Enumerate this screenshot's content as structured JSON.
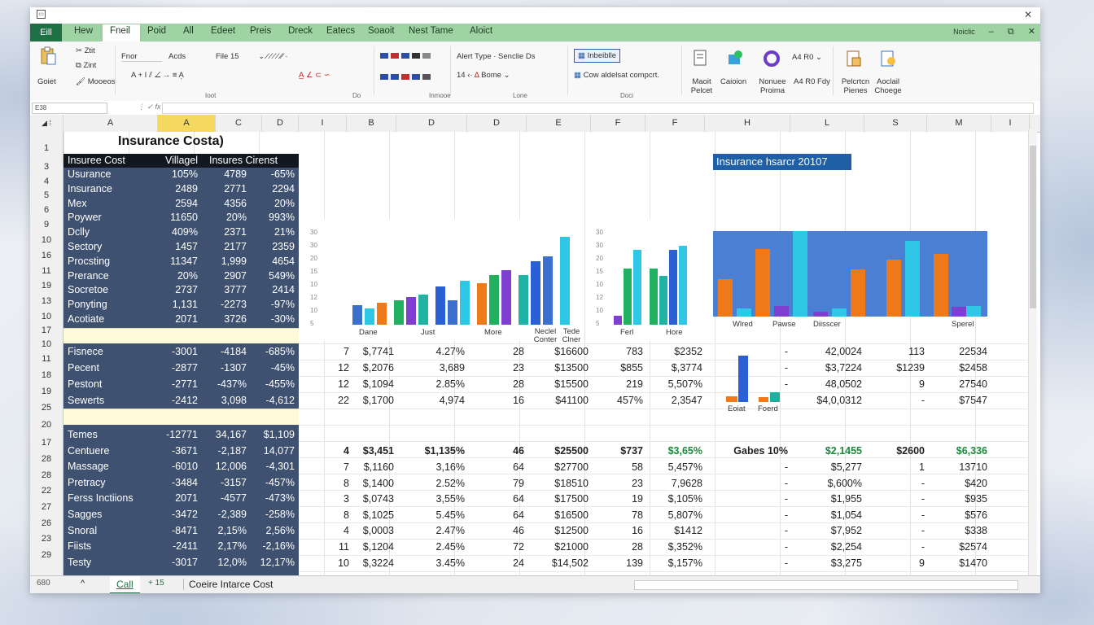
{
  "ribbon_tabs": [
    "Eill",
    "Hew",
    "Fneil",
    "Poid",
    "All",
    "Edeet",
    "Preis",
    "Dreck",
    "Eatecs",
    "Soaoit",
    "Nest Tame",
    "Aloict"
  ],
  "window_ctrls": [
    "Noiclic",
    "–",
    "⧉",
    "✕"
  ],
  "ribbon": {
    "paste_label": "Goiet",
    "clip_items": [
      "Ztit",
      "Zint",
      "Mooeos"
    ],
    "font_name": "Fnor",
    "font_size": "Acds",
    "font_menu": "File 15",
    "alert_type": "Alert Type · Senclie Ds",
    "bome": "Bome",
    "ibboi": "Inbeiblle",
    "cow_text": "Cow aldelsat compcrt.",
    "big_btns": [
      "Maoit Pelcet",
      "Caioion",
      "Nonuee Proima",
      "A4 R0 Fdy"
    ],
    "right_btns": [
      "Pelcrtcn Pienes",
      "Aoclail Choege"
    ],
    "group_labels": [
      "Ioot",
      "Do",
      "Inmooe",
      "Lone",
      "Doci"
    ]
  },
  "namebox": "E38",
  "columns": [
    "A",
    "A",
    "C",
    "D",
    "I",
    "B",
    "D",
    "D",
    "E",
    "F",
    "F",
    "H",
    "L",
    "S",
    "M",
    "I"
  ],
  "rows": [
    "1",
    "3",
    "4",
    "5",
    "6",
    "9",
    "10",
    "16",
    "11",
    "19",
    "13",
    "10",
    "17",
    "10",
    "11",
    "18",
    "19",
    "25",
    "20",
    "17",
    "28",
    "28",
    "22",
    "27",
    "26",
    "23",
    "29"
  ],
  "sheet_title": "Insurance Costa)",
  "table_header": [
    "Insuree Cost",
    "Villagel",
    "Insures Cirenst"
  ],
  "table_rows": [
    [
      "Usurance",
      "105%",
      "4789",
      "-65%"
    ],
    [
      "Insurance",
      "2489",
      "2771",
      "2294"
    ],
    [
      "Mex",
      "2594",
      "4356",
      "20%"
    ],
    [
      "Poywer",
      "11650",
      "20%",
      "993%"
    ],
    [
      "Dclly",
      "409%",
      "2371",
      "21%"
    ],
    [
      "Sectory",
      "1457",
      "2177",
      "2359"
    ],
    [
      "Procsting",
      "11347",
      "1,999",
      "4654"
    ],
    [
      "Prerance",
      "20%",
      "2907",
      "549%"
    ],
    [
      "Socretoe",
      "2737",
      "3777",
      "2414"
    ],
    [
      "Ponyting",
      "1,131",
      "-2273",
      "-97%"
    ],
    [
      "Acotiate",
      "2071",
      "3726",
      "-30%"
    ]
  ],
  "table_rows2": [
    [
      "Fisnece",
      "-3001",
      "-4184",
      "-685%"
    ],
    [
      "Pecent",
      "-2877",
      "-1307",
      "-45%"
    ],
    [
      "Pestont",
      "-2771",
      "-437%",
      "-455%"
    ],
    [
      "Sewerts",
      "-2412",
      "3,098",
      "-4,612"
    ]
  ],
  "table_rows3": [
    [
      "Temes",
      "-12771",
      "34,167",
      "$1,109"
    ],
    [
      "Centuere",
      "-3671",
      "-2,187",
      "14,077"
    ],
    [
      "Massage",
      "-6010",
      "12,006",
      "-4,301"
    ],
    [
      "Pretracy",
      "-3484",
      "-3157",
      "-457%"
    ],
    [
      "Ferss Inctiions",
      "2071",
      "-4577",
      "-473%"
    ],
    [
      "Sagges",
      "-3472",
      "-2,389",
      "-258%"
    ],
    [
      "Snoral",
      "-8471",
      "2,15%",
      "2,56%"
    ],
    [
      "Fiists",
      "-2411",
      "2,17%",
      "-2,16%"
    ],
    [
      "Testy",
      "-3017",
      "12,0%",
      "12,17%"
    ]
  ],
  "right_block1": [
    [
      "7",
      "$,7741",
      "4.27%",
      "28",
      "$16600",
      "783",
      "$2352",
      "-",
      "42,0024",
      "113",
      "22534"
    ],
    [
      "12",
      "$,2076",
      "3,689",
      "23",
      "$13500",
      "$855",
      "$,3774",
      "-",
      "$3,7224",
      "$1239",
      "$2458"
    ],
    [
      "12",
      "$,1094",
      "2.85%",
      "28",
      "$15500",
      "219",
      "5,507%",
      "-",
      "48,0502",
      "9",
      "27540"
    ],
    [
      "22",
      "$,1700",
      "4,974",
      "16",
      "$41100",
      "457%",
      "2,3547",
      "",
      "$4,0,0312",
      "-",
      "$7547"
    ]
  ],
  "bold_row": [
    "4",
    "$3,451",
    "$1,135%",
    "46",
    "$25500",
    "$737",
    "$3,65%",
    "Gabes 10%",
    "$2,1455",
    "$2600",
    "$6,336"
  ],
  "right_block2": [
    [
      "7",
      "$,1160",
      "3,16%",
      "64",
      "$27700",
      "58",
      "5,457%",
      "-",
      "$5,277",
      "1",
      "13710"
    ],
    [
      "8",
      "$,1400",
      "2.52%",
      "79",
      "$18510",
      "23",
      "7,9628",
      "-",
      "$,600%",
      "-",
      "$420"
    ],
    [
      "3",
      "$,0743",
      "3,55%",
      "64",
      "$17500",
      "19",
      "$,105%",
      "-",
      "$1,955",
      "-",
      "$935"
    ],
    [
      "8",
      "$,1025",
      "5.45%",
      "64",
      "$16500",
      "78",
      "5,807%",
      "-",
      "$1,054",
      "-",
      "$576"
    ],
    [
      "4",
      "$,0003",
      "2.47%",
      "46",
      "$12500",
      "16",
      "$1412",
      "-",
      "$7,952",
      "-",
      "$338"
    ],
    [
      "11",
      "$,1204",
      "2.45%",
      "72",
      "$21000",
      "28",
      "$,352%",
      "-",
      "$2,254",
      "-",
      "$2574"
    ],
    [
      "10",
      "$,3224",
      "3.45%",
      "24",
      "$14,502",
      "139",
      "$,157%",
      "-",
      "$3,275",
      "9",
      "$1470"
    ]
  ],
  "chart1": {
    "categories": [
      "Dane",
      "Just",
      "More",
      "Neclel Conter",
      "Tede Clner"
    ],
    "axis_ticks": [
      "30",
      "30",
      "20",
      "15",
      "10",
      "12",
      "10",
      "5"
    ],
    "colors": [
      "#3b6fd0",
      "#2ec7e6",
      "#f07a1a",
      "#20b060",
      "#7e3fd1",
      "#1fb3a3",
      "#2b5fd6"
    ],
    "series": [
      {
        "values": [
          7,
          6,
          8,
          9,
          10,
          11,
          14,
          9,
          16,
          15,
          18,
          20,
          18,
          23,
          25,
          32
        ]
      }
    ]
  },
  "chart2": {
    "categories": [
      "Ferl",
      "Hore"
    ],
    "axis_ticks": [
      "30",
      "30",
      "20",
      "15",
      "10",
      "12",
      "10",
      "5"
    ]
  },
  "chart3": {
    "title": "Insurance hsarcr 20107",
    "categories": [
      "Wlred",
      "Pawse",
      "Diisscer",
      "Sperel"
    ]
  },
  "chart4": {
    "categories": [
      "Eoiat",
      "Foerd"
    ]
  },
  "sheet_tabs": [
    "680",
    "^",
    "Call",
    "+ 15",
    "Coeire Intarce Cost"
  ]
}
